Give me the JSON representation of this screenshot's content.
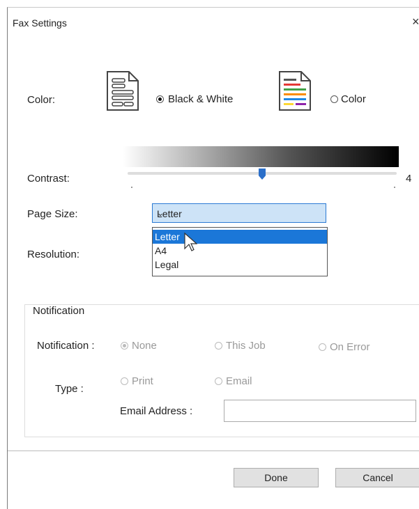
{
  "dialog": {
    "title": "Fax Settings",
    "close_glyph": "×"
  },
  "color": {
    "label": "Color:",
    "options": [
      {
        "label": "Black & White",
        "selected": true,
        "icon": "bw-document-icon"
      },
      {
        "label": "Color",
        "selected": false,
        "icon": "color-document-icon"
      }
    ]
  },
  "contrast": {
    "label": "Contrast:",
    "value": "4"
  },
  "page_size": {
    "label": "Page Size:",
    "selected": "Letter",
    "options": [
      "Letter",
      "A4",
      "Legal"
    ],
    "highlighted": "Letter"
  },
  "resolution": {
    "label": "Resolution:"
  },
  "notification": {
    "group_title": "Notification",
    "label": "Notification :",
    "options": [
      {
        "label": "None",
        "selected": true
      },
      {
        "label": "This Job",
        "selected": false
      },
      {
        "label": "On Error",
        "selected": false
      }
    ],
    "type_label": "Type :",
    "type_options": [
      {
        "label": "Print",
        "selected": false
      },
      {
        "label": "Email",
        "selected": false
      }
    ],
    "email_label": "Email Address :",
    "email_value": ""
  },
  "buttons": {
    "done": "Done",
    "cancel": "Cancel"
  },
  "colors": {
    "accent": "#1b77d8",
    "select_bg": "#cde3f7",
    "slider_thumb": "#2b6fc9"
  }
}
